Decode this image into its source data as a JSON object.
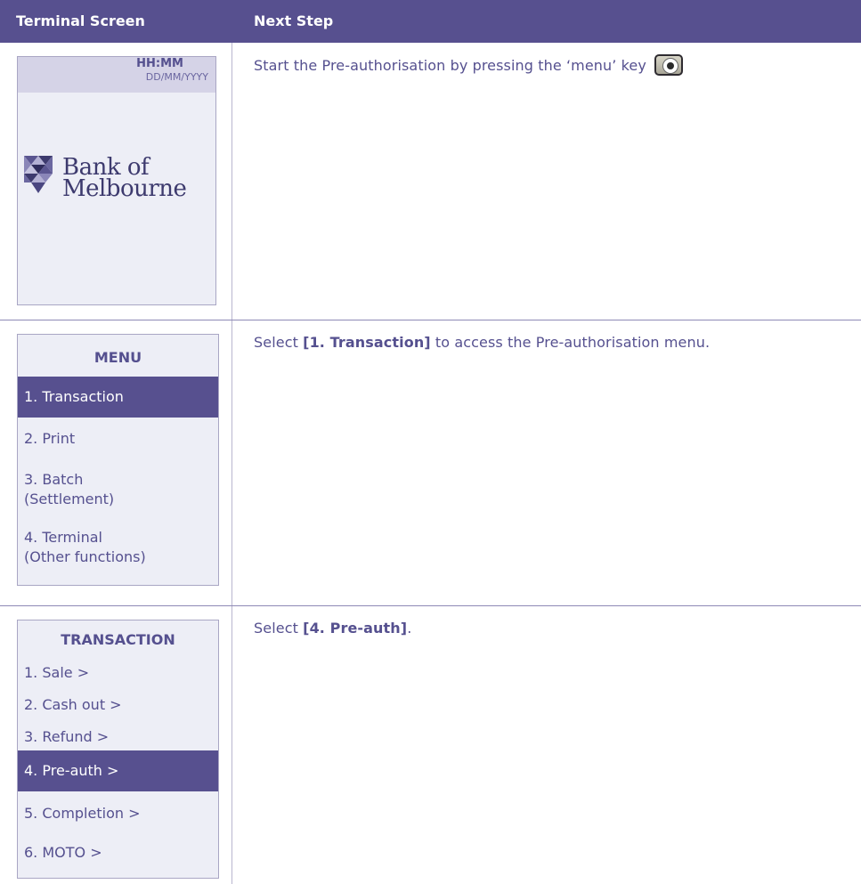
{
  "header": {
    "col1": "Terminal Screen",
    "col2": "Next Step"
  },
  "rows": [
    {
      "screen": {
        "time": "HH:MM",
        "date": "DD/MM/YYYY",
        "logo_line1": "Bank of",
        "logo_line2": "Melbourne"
      },
      "step": {
        "text": "Start the Pre-authorisation by pressing the ‘menu’ key",
        "key_icon": "menu-key-icon"
      }
    },
    {
      "screen": {
        "title": "MENU",
        "items": [
          "1. Transaction",
          "2. Print",
          "3. Batch",
          "(Settlement)",
          "4. Terminal",
          "(Other functions)"
        ],
        "selected": "1. Transaction"
      },
      "step": {
        "before": "Select ",
        "bold": "[1. Transaction]",
        "after": " to access the Pre-authorisation menu."
      }
    },
    {
      "screen": {
        "title": "TRANSACTION",
        "items": [
          "1. Sale >",
          "2. Cash out >",
          "3. Refund >",
          "4. Pre-auth >",
          "5. Completion >",
          "6. MOTO >"
        ],
        "selected": "4. Pre-auth >"
      },
      "step": {
        "before": "Select ",
        "bold": "[4. Pre-auth]",
        "after": "."
      }
    }
  ],
  "colors": {
    "brand": "#57508f",
    "screen_bg": "#edeef6",
    "status_bar": "#d5d3e7"
  }
}
